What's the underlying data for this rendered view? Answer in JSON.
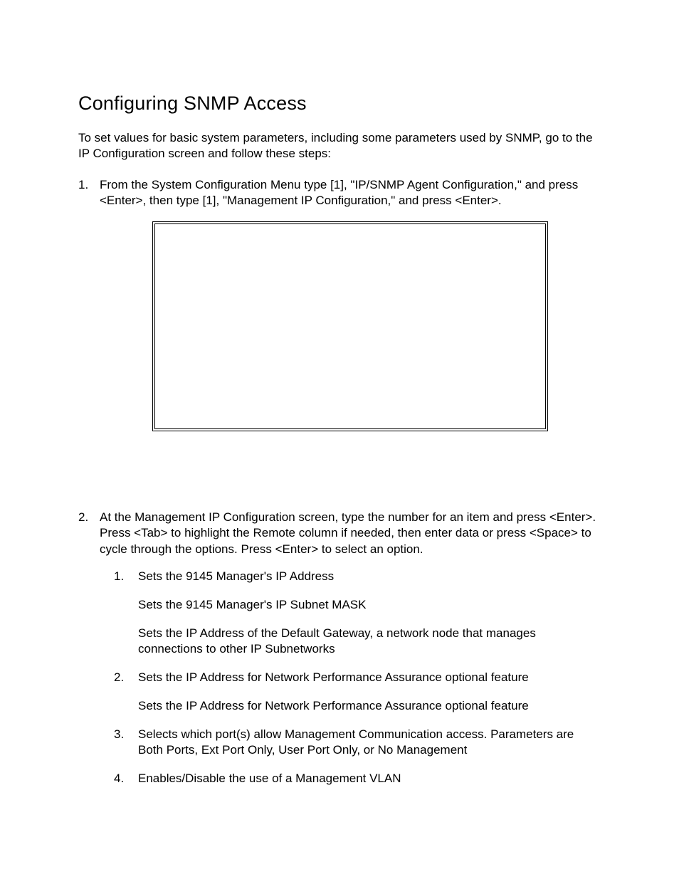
{
  "title": "Configuring SNMP Access",
  "intro": "To set values for basic system parameters, including some parameters used by SNMP, go to the IP Configuration screen and follow these steps:",
  "steps": [
    {
      "text": "From the System Configuration Menu type [1], \"IP/SNMP Agent Configuration,\" and press <Enter>, then type [1], \"Management IP Configuration,\" and press <Enter>."
    },
    {
      "text": "At the Management IP Configuration screen, type the number for an item and press <Enter>. Press <Tab> to highlight the Remote column if needed, then enter data or press <Space> to cycle through the options.  Press <Enter> to select an option.",
      "sub": [
        {
          "descs": [
            "Sets the 9145 Manager's IP Address",
            "Sets the 9145 Manager's IP Subnet MASK",
            "Sets the IP Address of the Default Gateway, a network node that manages connections to other IP Subnetworks"
          ]
        },
        {
          "descs": [
            "Sets the IP Address for Network Performance Assurance optional feature",
            "Sets the IP Address for Network Performance Assurance optional feature"
          ]
        },
        {
          "descs": [
            "Selects which port(s) allow Management Communication access.  Parameters are Both Ports, Ext Port Only, User Port Only, or No Management"
          ]
        },
        {
          "descs": [
            "Enables/Disable the use of a Management VLAN"
          ]
        }
      ]
    }
  ]
}
